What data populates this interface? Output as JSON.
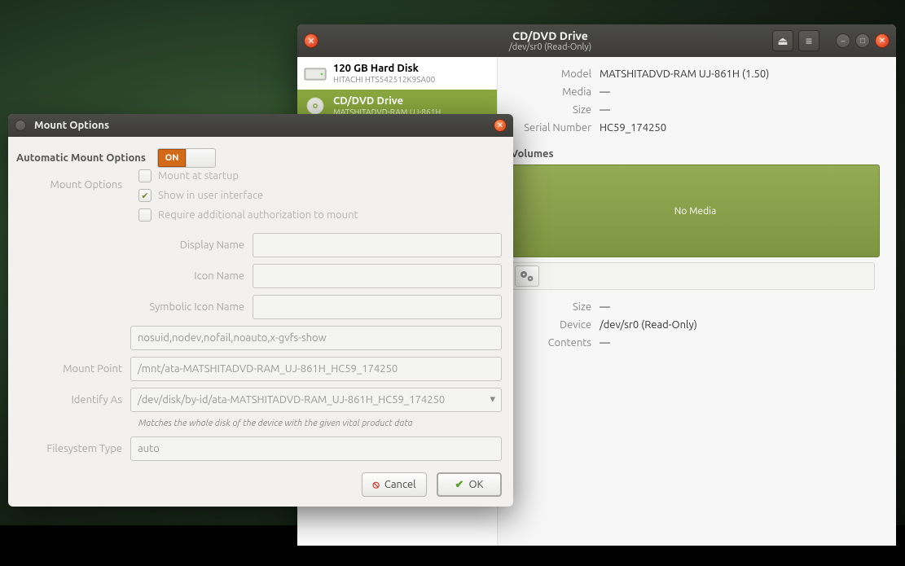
{
  "main_window": {
    "title": "CD/DVD Drive",
    "subtitle": "/dev/sr0 (Read-Only)",
    "eject_icon": "eject-icon",
    "menu_icon": "hamburger-icon"
  },
  "disk_list": [
    {
      "name": "120 GB Hard Disk",
      "sub": "HITACHI HTS542512K9SA00",
      "selected": false,
      "icon": "hard-disk-icon"
    },
    {
      "name": "CD/DVD Drive",
      "sub": "MATSHITADVD-RAM UJ-861H",
      "selected": true,
      "icon": "optical-disc-icon"
    }
  ],
  "detail": {
    "model_label": "Model",
    "model_value": "MATSHITADVD-RAM UJ-861H (1.50)",
    "media_label": "Media",
    "media_value": "—",
    "size_label": "Size",
    "size_value": "—",
    "serial_label": "Serial Number",
    "serial_value": "HC59_174250",
    "volumes_heading": "Volumes",
    "no_media": "No Media",
    "size2_label": "Size",
    "size2_value": "—",
    "device_label": "Device",
    "device_value": "/dev/sr0 (Read-Only)",
    "contents_label": "Contents",
    "contents_value": "—"
  },
  "dialog": {
    "title": "Mount Options",
    "auto_label": "Automatic Mount Options",
    "switch_on": "ON",
    "mount_options_label": "Mount Options",
    "chk_startup": "Mount at startup",
    "chk_show_ui": "Show in user interface",
    "chk_auth": "Require additional authorization to mount",
    "display_name_label": "Display Name",
    "icon_name_label": "Icon Name",
    "symbolic_icon_label": "Symbolic Icon Name",
    "opts_value": "nosuid,nodev,nofail,noauto,x-gvfs-show",
    "mount_point_label": "Mount Point",
    "mount_point_value": "/mnt/ata-MATSHITADVD-RAM_UJ-861H_HC59_174250",
    "identify_label": "Identify As",
    "identify_value": "/dev/disk/by-id/ata-MATSHITADVD-RAM_UJ-861H_HC59_174250",
    "identify_hint": "Matches the whole disk of the device with the given vital product data",
    "fstype_label": "Filesystem Type",
    "fstype_value": "auto",
    "cancel": "Cancel",
    "ok": "OK"
  }
}
